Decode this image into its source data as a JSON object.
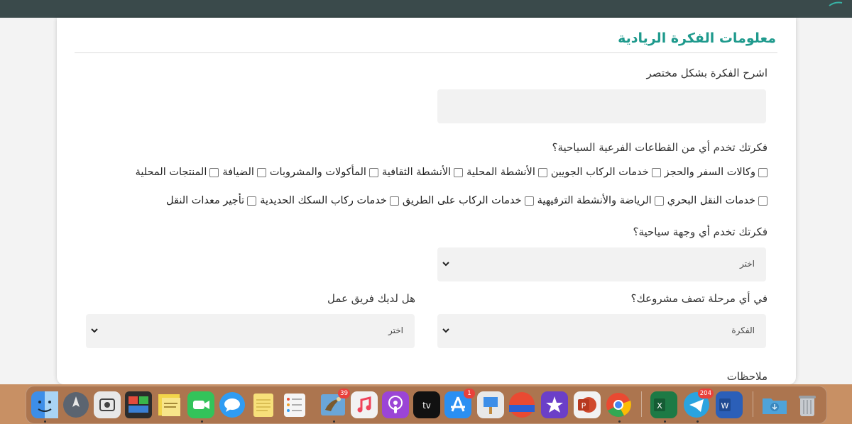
{
  "form": {
    "section_title": "معلومات الفكرة الريادية",
    "idea_label": "اشرح الفكرة بشكل مختصر",
    "idea_value": "",
    "sectors_label": "فكرتك تخدم أي من القطاعات الفرعية السياحية؟",
    "sectors_row1": [
      "وكالات السفر والحجز",
      "خدمات الركاب الجويين",
      "الأنشطة المحلية",
      "الأنشطة الثقافية",
      "المأكولات والمشروبات",
      "الضيافة",
      "المنتجات المحلية"
    ],
    "sectors_row2": [
      "خدمات النقل البحري",
      "الرياضة والأنشطة الترفيهية",
      "خدمات الركاب على الطريق",
      "خدمات ركاب السكك الحديدية",
      "تأجير معدات النقل"
    ],
    "destination_label": "فكرتك تخدم أي وجهة سياحية؟",
    "destination_value": "اختر",
    "stage_label": "في أي مرحلة تصف مشروعك؟",
    "stage_value": "الفكرة",
    "team_label": "هل لديك فريق عمل",
    "team_value": "اختر",
    "notes_label": "ملاحظات"
  },
  "dock": {
    "apps": [
      {
        "name": "finder-icon",
        "color": "#3d8ee8"
      },
      {
        "name": "launchpad-icon",
        "color": "#5b6470"
      },
      {
        "name": "screenshot-icon",
        "color": "#e8e8e8"
      },
      {
        "name": "photo-booth-icon",
        "color": "#2c2c2c"
      },
      {
        "name": "stickies-icon",
        "color": "#f2d54a"
      },
      {
        "name": "facetime-icon",
        "color": "#33c35a"
      },
      {
        "name": "messages-icon",
        "color": "#2f9cf3"
      },
      {
        "name": "notes-icon",
        "color": "#f7e07a"
      },
      {
        "name": "reminders-icon",
        "color": "#f5f5f5"
      },
      {
        "name": "mail-icon",
        "color": "#6aa6d8",
        "badge": "39"
      },
      {
        "name": "music-icon",
        "color": "#f2f2f2"
      },
      {
        "name": "podcasts-icon",
        "color": "#9b45d6"
      },
      {
        "name": "apple-tv-icon",
        "color": "#111111"
      },
      {
        "name": "app-store-icon",
        "color": "#2a8ff2",
        "badge": "1"
      },
      {
        "name": "keynote-icon",
        "color": "#e8e8e8"
      },
      {
        "name": "app-icon",
        "color": "#e94a32"
      },
      {
        "name": "imovie-icon",
        "color": "#6b3fc8"
      },
      {
        "name": "powerpoint-icon",
        "color": "#f2f2f2"
      },
      {
        "name": "chrome-icon",
        "color": "#f4f4f4"
      },
      {
        "name": "excel-icon",
        "color": "#1d7a45"
      },
      {
        "name": "telegram-icon",
        "color": "#2aa3df",
        "badge": "204"
      },
      {
        "name": "word-icon",
        "color": "#2b5fb8"
      },
      {
        "name": "downloads-folder-icon",
        "color": "#4fa3d9"
      },
      {
        "name": "trash-icon",
        "color": "#9aa0a6"
      }
    ],
    "badge_mail": "39",
    "badge_appstore": "1",
    "badge_telegram": "204"
  }
}
